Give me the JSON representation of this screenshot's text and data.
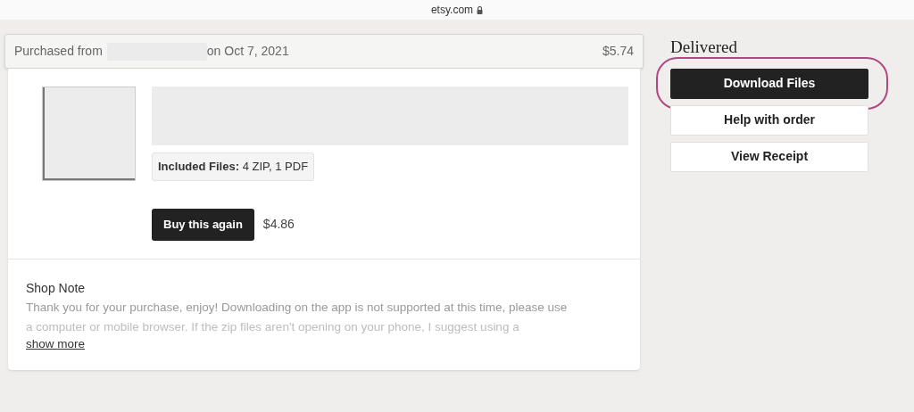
{
  "address_bar": {
    "url": "etsy.com",
    "secure": true
  },
  "order": {
    "purchased_prefix": "Purchased from",
    "date": "on Oct 7, 2021",
    "total": "$5.74",
    "item": {
      "files_label": "Included Files:",
      "files_value": "4 ZIP, 1 PDF",
      "buy_again": "Buy this again",
      "price": "$4.86"
    },
    "shop_note": {
      "title": "Shop Note",
      "lines": [
        "Thank you for your purchase, enjoy! Downloading on the app is not supported at this time, please use",
        "a computer or mobile browser. If the zip files aren't opening on your phone, I suggest using a"
      ],
      "show_more": "show more"
    }
  },
  "status": "Delivered",
  "actions": [
    {
      "label": "Download Files",
      "kind": "primary",
      "highlighted": true
    },
    {
      "label": "Help with order",
      "kind": "secondary",
      "highlighted": false
    },
    {
      "label": "View Receipt",
      "kind": "secondary",
      "highlighted": false
    }
  ]
}
